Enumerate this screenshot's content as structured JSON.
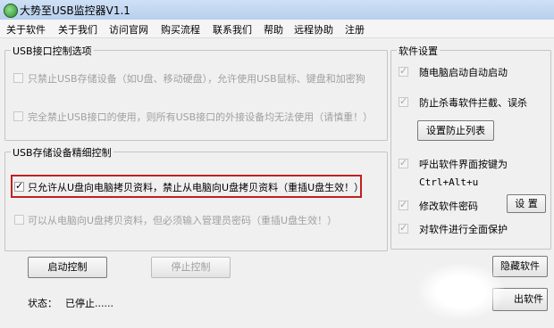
{
  "window": {
    "title": "大势至USB监控器V1.1"
  },
  "menu": [
    "关于软件",
    "关于我们",
    "访问官网",
    "购买流程",
    "联系我们",
    "帮助",
    "远程协助",
    "注册"
  ],
  "usb_port_control": {
    "title": "USB接口控制选项",
    "options": [
      {
        "label": "只禁止USB存储设备（如U盘、移动硬盘），允许使用USB鼠标、键盘和加密狗",
        "checked": false,
        "disabled": true
      },
      {
        "label": "完全禁止USB接口的使用，则所有USB接口的外接设备均无法使用（请慎重！）",
        "checked": false,
        "disabled": true
      }
    ]
  },
  "usb_storage_control": {
    "title": "USB存储设备精细控制",
    "options": [
      {
        "label": "只允许从U盘向电脑拷贝资料，禁止从电脑向U盘拷贝资料（重插U盘生效！）",
        "checked": true,
        "disabled": false
      },
      {
        "label": "可以从电脑向U盘拷贝资料，但必须输入管理员密码（重插U盘生效！）",
        "checked": false,
        "disabled": true
      }
    ]
  },
  "software_settings": {
    "title": "软件设置",
    "options": [
      {
        "label": "随电脑启动自动启动",
        "checked": true,
        "disabled": true
      },
      {
        "label": "防止杀毒软件拦截、误杀",
        "checked": true,
        "disabled": true
      },
      {
        "label": "呼出软件界面按键为",
        "checked": true,
        "disabled": true
      },
      {
        "label": "修改软件密码",
        "checked": true,
        "disabled": true
      },
      {
        "label": "对软件进行全面保护",
        "checked": true,
        "disabled": true
      }
    ],
    "prevent_list_button": "设置防止列表",
    "hotkey": "Ctrl+Alt+u",
    "password_set_button": "设 置"
  },
  "controls": {
    "start_button": "启动控制",
    "stop_button": "停止控制",
    "hide_button": "隐藏软件",
    "exit_button": "出软件"
  },
  "status": {
    "label": "状态：",
    "value": "已停止......"
  }
}
